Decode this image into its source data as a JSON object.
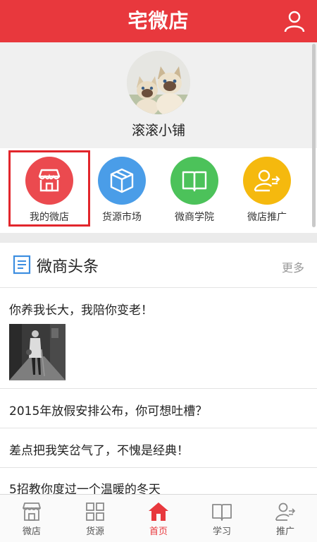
{
  "header": {
    "title": "宅微店"
  },
  "profile": {
    "shop_name": "滚滚小铺"
  },
  "entries": [
    {
      "label": "我的微店",
      "icon": "store-icon",
      "color": "#eb4a4f"
    },
    {
      "label": "货源市场",
      "icon": "box-icon",
      "color": "#4a9de8"
    },
    {
      "label": "微商学院",
      "icon": "book-icon",
      "color": "#4cc25a"
    },
    {
      "label": "微店推广",
      "icon": "promote-icon",
      "color": "#f5b90e"
    }
  ],
  "news": {
    "title": "微商头条",
    "more": "更多",
    "items": [
      {
        "title": "你养我长大，我陪你变老！"
      },
      {
        "title": "2015年放假安排公布，你可想吐槽？"
      },
      {
        "title": "差点把我笑岔气了，不愧是经典！"
      },
      {
        "title": "5招教你度过一个温暖的冬天"
      }
    ]
  },
  "tabs": [
    {
      "label": "微店",
      "icon": "store-icon"
    },
    {
      "label": "货源",
      "icon": "grid-icon"
    },
    {
      "label": "首页",
      "icon": "home-icon",
      "active": true
    },
    {
      "label": "学习",
      "icon": "book-icon"
    },
    {
      "label": "推广",
      "icon": "promote-icon"
    }
  ]
}
